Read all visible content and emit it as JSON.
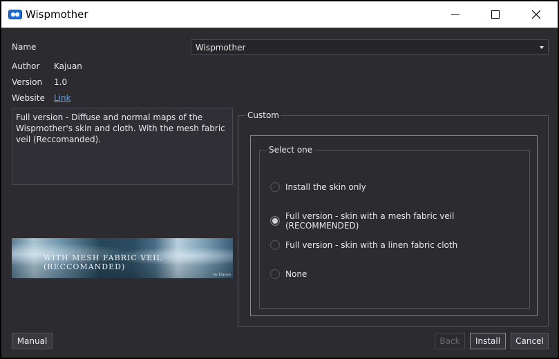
{
  "window": {
    "title": "Wispmother",
    "controls": {
      "minimize": "minimize-icon",
      "maximize": "maximize-icon",
      "close": "close-icon"
    }
  },
  "info": {
    "name_label": "Name",
    "name_value": "Wispmother",
    "author_label": "Author",
    "author_value": "Kajuan",
    "version_label": "Version",
    "version_value": "1.0",
    "website_label": "Website",
    "website_link": "Link"
  },
  "description": "Full version - Diffuse and normal maps of the Wispmother's skin and cloth. With the mesh fabric veil (Reccomanded).",
  "banner": {
    "text": "WITH MESH FABRIC VEIL (RECCOMANDED)",
    "signature": "by Kajuan"
  },
  "custom_group": {
    "title": "Custom",
    "select_title": "Select one",
    "options": [
      {
        "label": "Install the skin only",
        "checked": false
      },
      {
        "label": "Full version - skin with a mesh fabric veil (RECOMMENDED)",
        "checked": true
      },
      {
        "label": "Full version - skin with a linen fabric cloth",
        "checked": false
      },
      {
        "label": "None",
        "checked": false
      }
    ]
  },
  "buttons": {
    "manual": "Manual",
    "back": "Back",
    "install": "Install",
    "cancel": "Cancel"
  },
  "colors": {
    "background": "#2b2b30",
    "titlebar": "#ffffff",
    "link": "#4aa3ff",
    "text": "#e8e8e8"
  }
}
